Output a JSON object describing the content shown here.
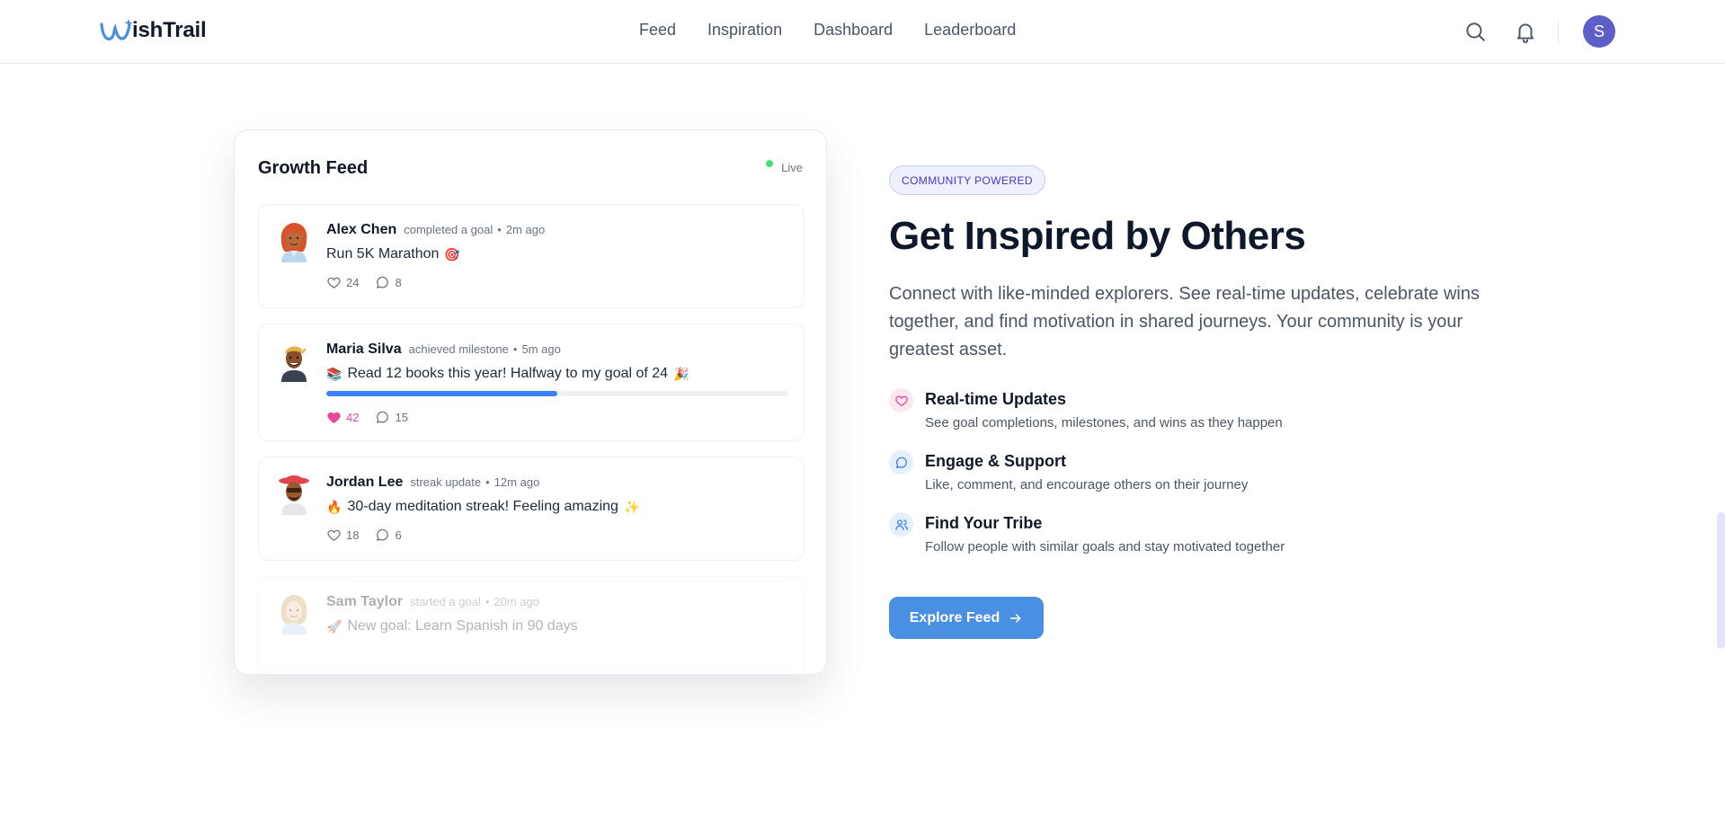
{
  "brand": {
    "name": "ishTrail"
  },
  "nav": {
    "links": [
      "Feed",
      "Inspiration",
      "Dashboard",
      "Leaderboard"
    ],
    "user_initial": "S"
  },
  "feed": {
    "title": "Growth Feed",
    "live_label": "Live",
    "posts": [
      {
        "name": "Alex Chen",
        "action": "completed a goal",
        "separator": "•",
        "time": "2m ago",
        "text": "Run 5K Marathon",
        "emoji_after": "🎯",
        "likes": "24",
        "comments": "8",
        "liked": false
      },
      {
        "name": "Maria Silva",
        "action": "achieved milestone",
        "separator": "•",
        "time": "5m ago",
        "emoji_before": "📚",
        "text": "Read 12 books this year! Halfway to my goal of 24",
        "emoji_after": "🎉",
        "progress": 0.5,
        "likes": "42",
        "comments": "15",
        "liked": true
      },
      {
        "name": "Jordan Lee",
        "action": "streak update",
        "separator": "•",
        "time": "12m ago",
        "emoji_before": "🔥",
        "text": "30-day meditation streak! Feeling amazing",
        "emoji_after": "✨",
        "likes": "18",
        "comments": "6",
        "liked": false
      },
      {
        "name": "Sam Taylor",
        "action": "started a goal",
        "separator": "•",
        "time": "20m ago",
        "emoji_before": "🚀",
        "text": "New goal: Learn Spanish in 90 days"
      }
    ]
  },
  "section": {
    "badge": "COMMUNITY POWERED",
    "headline": "Get Inspired by Others",
    "lede": "Connect with like-minded explorers. See real-time updates, celebrate wins together, and find motivation in shared journeys. Your community is your greatest asset.",
    "features": [
      {
        "icon": "heart-icon",
        "title": "Real-time Updates",
        "desc": "See goal completions, milestones, and wins as they happen",
        "color": "#ec4899",
        "bg": "#fde7f1"
      },
      {
        "icon": "message-circle-icon",
        "title": "Engage & Support",
        "desc": "Like, comment, and encourage others on their journey",
        "color": "#3b82f6",
        "bg": "#e6effd"
      },
      {
        "icon": "users-icon",
        "title": "Find Your Tribe",
        "desc": "Follow people with similar goals and stay motivated together",
        "color": "#3b82f6",
        "bg": "#e6effd"
      }
    ],
    "cta_label": "Explore Feed"
  },
  "colors": {
    "accent": "#4a90e2",
    "badge_text": "#4338ca",
    "avatar_bg": "#5b5fc7",
    "like_pink": "#ec4899",
    "live_green": "#4ade80",
    "progress_blue": "#3b82f6"
  }
}
